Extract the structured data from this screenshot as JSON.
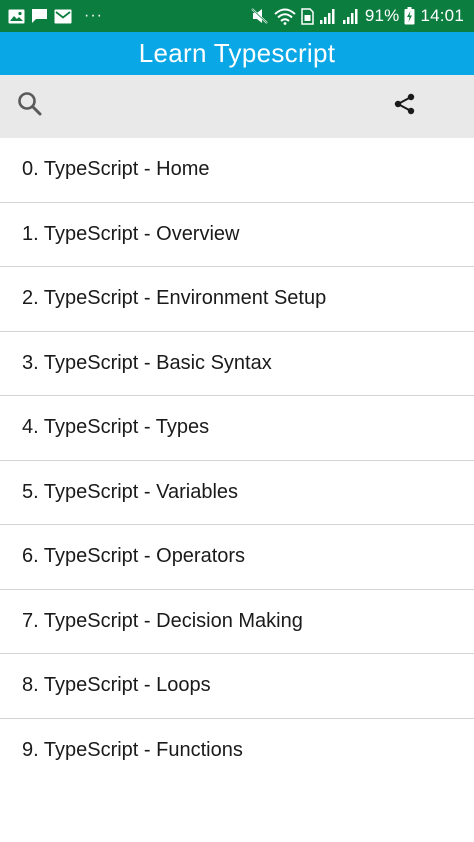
{
  "status_bar": {
    "battery": "91%",
    "time": "14:01",
    "overflow": "···",
    "left_icons": [
      "image-icon",
      "message-icon",
      "mail-icon"
    ],
    "right_icons": [
      "mute-icon",
      "wifi-icon",
      "signal-icon",
      "signal-icon",
      "battery-icon"
    ]
  },
  "app_bar": {
    "title": "Learn Typescript",
    "color": "#0aa7e6"
  },
  "toolbar": {
    "search_icon": "search-icon",
    "share_icon": "share-icon"
  },
  "list": {
    "items": [
      {
        "label": "0. TypeScript - Home"
      },
      {
        "label": "1. TypeScript - Overview"
      },
      {
        "label": "2. TypeScript - Environment Setup"
      },
      {
        "label": "3. TypeScript - Basic Syntax"
      },
      {
        "label": "4. TypeScript - Types"
      },
      {
        "label": "5. TypeScript - Variables"
      },
      {
        "label": "6. TypeScript - Operators"
      },
      {
        "label": "7. TypeScript - Decision Making"
      },
      {
        "label": "8. TypeScript - Loops"
      },
      {
        "label": "9. TypeScript - Functions"
      }
    ]
  }
}
